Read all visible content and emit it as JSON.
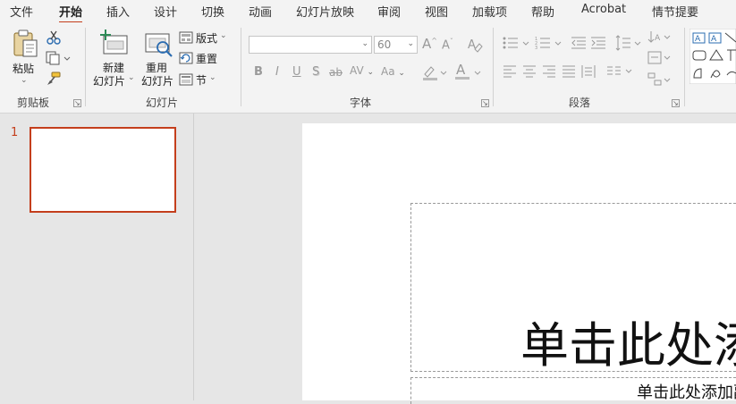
{
  "menu": {
    "tabs": [
      {
        "label": "文件"
      },
      {
        "label": "开始"
      },
      {
        "label": "插入"
      },
      {
        "label": "设计"
      },
      {
        "label": "切换"
      },
      {
        "label": "动画"
      },
      {
        "label": "幻灯片放映"
      },
      {
        "label": "审阅"
      },
      {
        "label": "视图"
      },
      {
        "label": "加载项"
      },
      {
        "label": "帮助"
      },
      {
        "label": "Acrobat"
      },
      {
        "label": "情节提要"
      }
    ],
    "active_tab": "开始"
  },
  "clipboard": {
    "paste_label": "粘贴",
    "group_label": "剪贴板"
  },
  "slides_group": {
    "new_slide_line1": "新建",
    "new_slide_line2": "幻灯片",
    "reuse_line1": "重用",
    "reuse_line2": "幻灯片",
    "layout_label": "版式",
    "reset_label": "重置",
    "section_label": "节",
    "group_label": "幻灯片"
  },
  "font_group": {
    "font_name": "",
    "font_size": "60",
    "bold": "B",
    "italic": "I",
    "underline": "U",
    "shadow": "S",
    "strike": "ab",
    "spacing": "AV",
    "case": "Aa",
    "grow": "A",
    "shrink": "A",
    "group_label": "字体"
  },
  "paragraph_group": {
    "group_label": "段落"
  },
  "thumbnails": {
    "slide_number": "1"
  },
  "slide": {
    "title_placeholder": "单击此处添加标题",
    "subtitle_placeholder": "单击此处添加副标题"
  },
  "colors": {
    "accent": "#c43e1c",
    "ribbon_bg": "#f3f3f3",
    "workspace_bg": "#e6e6e6"
  }
}
